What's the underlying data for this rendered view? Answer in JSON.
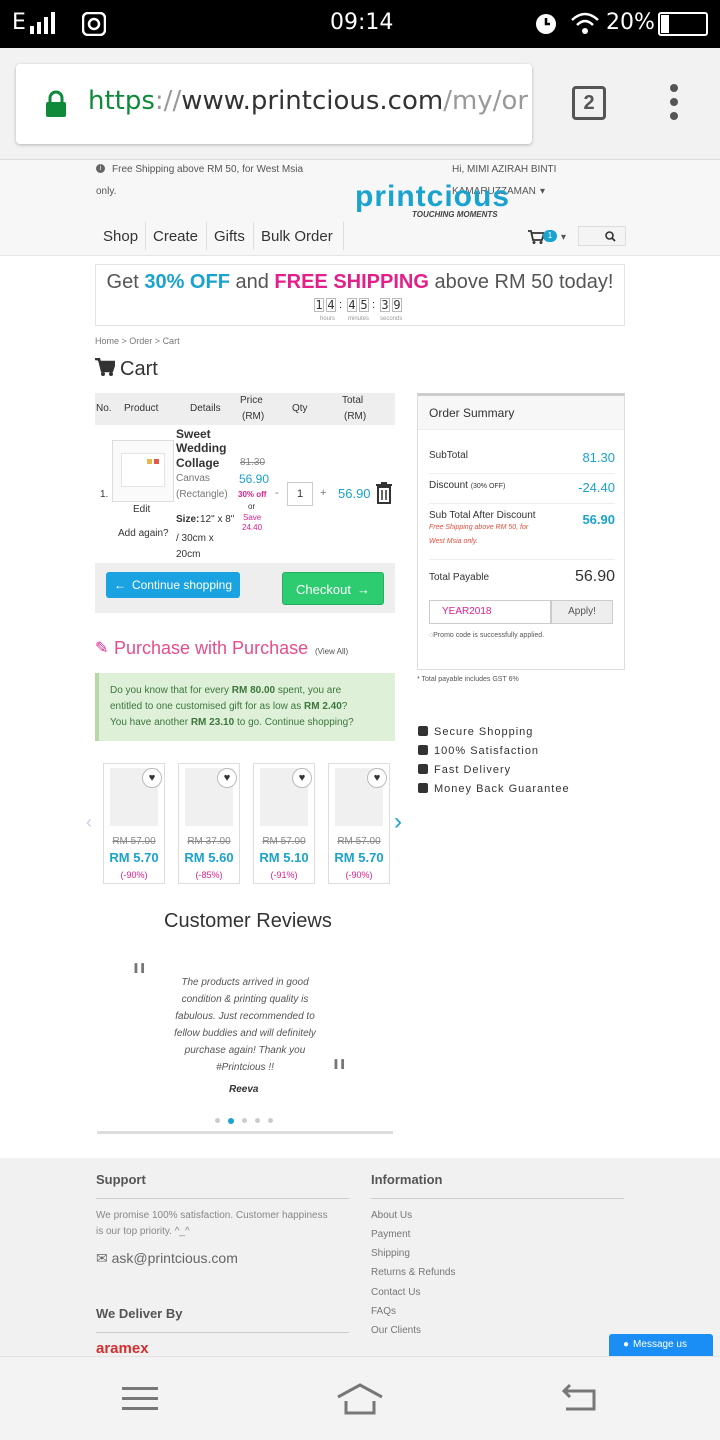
{
  "status": {
    "carrier": "E",
    "time": "09:14",
    "battery": "20%"
  },
  "browser": {
    "url_scheme": "https",
    "url_sep": "://",
    "url_domain": "www.printcious.com",
    "url_path": "/my/order",
    "tab_count": "2"
  },
  "topbar": {
    "shipping_note": "Free Shipping above RM 50, for West Msia",
    "shipping_note2": "only.",
    "user_greeting": "Hi, MIMI AZIRAH BINTI",
    "user_greeting2": "KAMARUZZAMAN",
    "logo": "printcious",
    "tagline": "TOUCHING MOMENTS"
  },
  "nav": {
    "items": [
      "Shop",
      "Create",
      "Gifts",
      "Bulk Order"
    ],
    "cart_count": "1"
  },
  "promo": {
    "get": "Get",
    "off": "30% OFF",
    "and": "and",
    "free": "FREE SHIPPING",
    "rest": "above RM 50 today!",
    "digits": [
      "1",
      "4",
      "4",
      "5",
      "3",
      "9"
    ],
    "labels": [
      "hours",
      "minutes",
      "seconds"
    ]
  },
  "breadcrumb": {
    "home": "Home",
    "order": "Order",
    "cart": "Cart"
  },
  "cart": {
    "title": "Cart",
    "headers": {
      "no": "No.",
      "product": "Product",
      "details": "Details",
      "price": "Price",
      "price_unit": "(RM)",
      "qty": "Qty",
      "total": "Total",
      "total_unit": "(RM)"
    },
    "item": {
      "no": "1.",
      "name1": "Sweet",
      "name2": "Wedding",
      "name3": "Collage",
      "material1": "Canvas",
      "material2": "(Rectangle)",
      "size_label": "Size:",
      "size1": "12\" x 8\"",
      "size2": "/ 30cm x",
      "size3": "20cm",
      "old_price": "81.30",
      "new_price": "56.90",
      "discount": "30% off",
      "or": "or",
      "save": "Save",
      "save_amt": "24.40",
      "qty": "1",
      "total": "56.90",
      "edit": "Edit",
      "add_again": "Add again?"
    },
    "continue": "Continue shopping",
    "checkout": "Checkout"
  },
  "summary": {
    "title": "Order Summary",
    "subtotal_label": "SubTotal",
    "subtotal": "81.30",
    "discount_label": "Discount",
    "discount_note": "(30% OFF)",
    "discount": "-24.40",
    "after_label": "Sub Total After Discount",
    "after_note1": "Free Shipping above RM 50, for",
    "after_note2": "West Msia only.",
    "after": "56.90",
    "payable_label": "Total Payable",
    "payable": "56.90",
    "promo_code": "YEAR2018",
    "apply": "Apply!",
    "promo_msg": "Promo code is successfully applied.",
    "gst_note": "* Total payable includes GST 6%"
  },
  "features": [
    "Secure Shopping",
    "100% Satisfaction",
    "Fast Delivery",
    "Money Back Guarantee"
  ],
  "pwp": {
    "title": "Purchase with Purchase",
    "view_all": "(View All)",
    "msg1a": "Do you know that for every ",
    "msg1b": "RM 80.00",
    "msg1c": " spent, you are",
    "msg2a": "entitled to one customised gift for as low as ",
    "msg2b": "RM 2.40",
    "msg2c": "?",
    "msg3a": "You have another ",
    "msg3b": "RM 23.10",
    "msg3c": " to go. Continue shopping?",
    "products": [
      {
        "old": "RM 57.00",
        "new": "RM 5.70",
        "pct": "(-90%)"
      },
      {
        "old": "RM 37.00",
        "new": "RM 5.60",
        "pct": "(-85%)"
      },
      {
        "old": "RM 57.00",
        "new": "RM 5.10",
        "pct": "(-91%)"
      },
      {
        "old": "RM 57.00",
        "new": "RM 5.70",
        "pct": "(-90%)"
      }
    ]
  },
  "reviews": {
    "title": "Customer Reviews",
    "lines": [
      "The products arrived in good",
      "condition & printing quality is",
      "fabulous. Just recommended to",
      "fellow buddies and will definitely",
      "purchase again! Thank you",
      "#Printcious !!"
    ],
    "author": "Reeva"
  },
  "footer": {
    "support_title": "Support",
    "support_text1": "We promise 100% satisfaction. Customer happiness",
    "support_text2": "is our top priority. ^_^",
    "email": "ask@printcious.com",
    "info_title": "Information",
    "links": [
      "About Us",
      "Payment",
      "Shipping",
      "Returns & Refunds",
      "Contact Us",
      "FAQs",
      "Our Clients"
    ],
    "deliver_title": "We Deliver By",
    "courier": "aramex",
    "message_us": "Message us"
  },
  "colors": {
    "accent_cyan": "#1aa3cf",
    "accent_pink": "#e21f8b",
    "green": "#2ecc71",
    "blue_btn": "#1aa3e0"
  }
}
